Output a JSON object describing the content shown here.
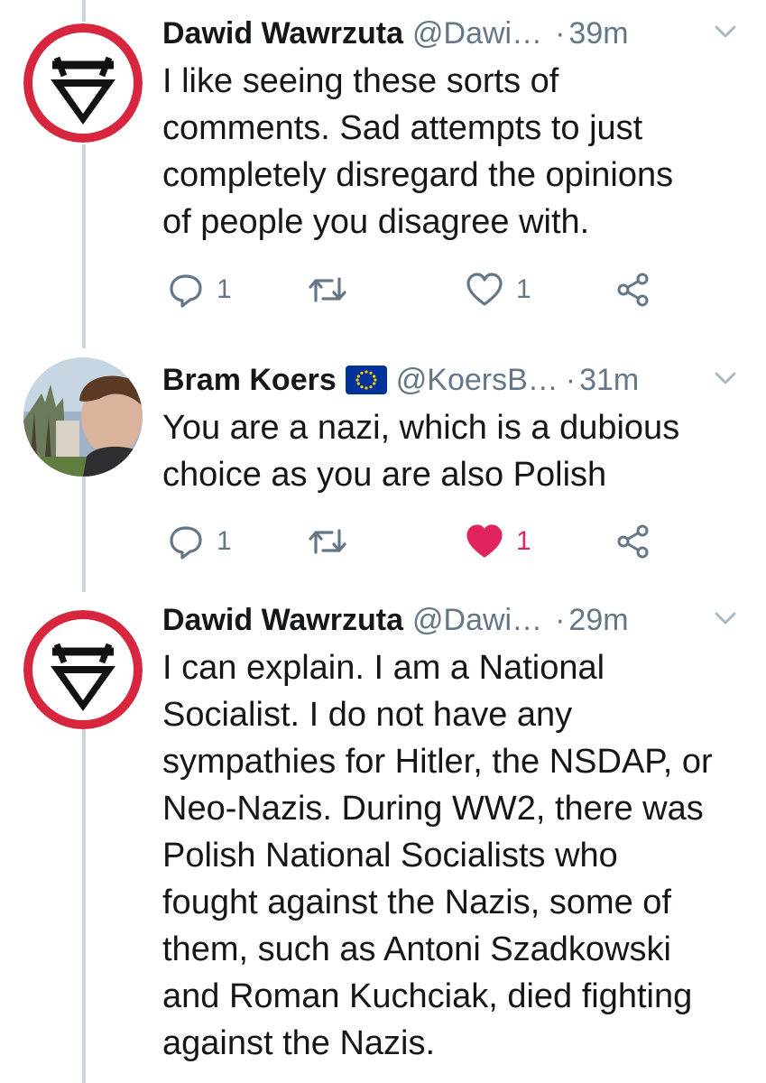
{
  "tweets": [
    {
      "name": "Dawid Wawrzuta",
      "handle": "@Dawi…",
      "dot": "·",
      "time": "39m",
      "avatar_icon": "red-circle-slashed-triangle-logo",
      "lines": [
        "I like seeing these sorts of",
        "comments. Sad attempts to just",
        "completely disregard the opinions",
        "of people you disagree with."
      ],
      "reply_count": "1",
      "retweet_count": "",
      "like_count": "1",
      "liked": false
    },
    {
      "name": "Bram Koers",
      "handle": "@KoersB…",
      "dot": "·",
      "time": "31m",
      "avatar_icon": "profile-photo",
      "badge_icon": "eu-flag-icon",
      "lines": [
        "You are a nazi, which is a dubious",
        "choice as you are also Polish"
      ],
      "reply_count": "1",
      "retweet_count": "",
      "like_count": "1",
      "liked": true
    },
    {
      "name": "Dawid Wawrzuta",
      "handle": "@Dawi…",
      "dot": "·",
      "time": "29m",
      "avatar_icon": "red-circle-slashed-triangle-logo",
      "lines": [
        "I can explain. I am a National",
        "Socialist. I do not have any",
        "sympathies for Hitler, the NSDAP, or",
        "Neo-Nazis. During WW2, there was",
        "Polish National Socialists who",
        "fought against the Nazis, some of",
        "them, such as Antoni Szadkowski",
        "and Roman Kuchciak, died fighting",
        "against the Nazis."
      ]
    }
  ],
  "colors": {
    "text": "#14171a",
    "muted": "#657786",
    "like_active": "#e0245e",
    "thread_line": "#ccd6dd",
    "eu_blue": "#003399",
    "eu_star": "#ffcc00",
    "logo_red": "#d7263d"
  }
}
